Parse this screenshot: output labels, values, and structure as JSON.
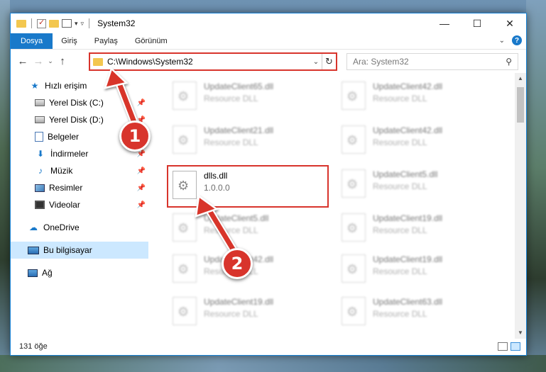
{
  "window": {
    "title": "System32"
  },
  "ribbon": {
    "tabs": [
      "Dosya",
      "Giriş",
      "Paylaş",
      "Görünüm"
    ]
  },
  "address": {
    "path": "C:\\Windows\\System32"
  },
  "search": {
    "placeholder": "Ara: System32"
  },
  "sidebar": {
    "items": [
      {
        "label": "Hızlı erişim",
        "icon": "star-icon"
      },
      {
        "label": "Yerel Disk (C:)",
        "icon": "drive-icon",
        "pinned": true
      },
      {
        "label": "Yerel Disk (D:)",
        "icon": "drive-icon",
        "pinned": true
      },
      {
        "label": "Belgeler",
        "icon": "document-icon",
        "pinned": true
      },
      {
        "label": "İndirmeler",
        "icon": "download-icon",
        "pinned": true
      },
      {
        "label": "Müzik",
        "icon": "music-icon",
        "pinned": true
      },
      {
        "label": "Resimler",
        "icon": "picture-icon",
        "pinned": true
      },
      {
        "label": "Videolar",
        "icon": "video-icon",
        "pinned": true
      },
      {
        "label": "OneDrive",
        "icon": "cloud-icon"
      },
      {
        "label": "Bu bilgisayar",
        "icon": "computer-icon",
        "selected": true
      },
      {
        "label": "Ağ",
        "icon": "network-icon"
      }
    ]
  },
  "files": [
    {
      "name": "UpdateClient65.dll",
      "desc": "Resource DLL"
    },
    {
      "name": "UpdateClient42.dll",
      "desc": "Resource DLL"
    },
    {
      "name": "UpdateClient21.dll",
      "desc": "Resource DLL"
    },
    {
      "name": "UpdateClient42.dll",
      "desc": "Resource DLL"
    },
    {
      "name": "dlls.dll",
      "desc": "1.0.0.0"
    },
    {
      "name": "UpdateClient5.dll",
      "desc": "Resource DLL"
    },
    {
      "name": "UpdateClient5.dll",
      "desc": "Resource DLL"
    },
    {
      "name": "UpdateClient19.dll",
      "desc": "Resource DLL"
    },
    {
      "name": "UpdateClient42.dll",
      "desc": "Resource DLL"
    },
    {
      "name": "UpdateClient19.dll",
      "desc": "Resource DLL"
    },
    {
      "name": "UpdateClient19.dll",
      "desc": "Resource DLL"
    },
    {
      "name": "UpdateClient63.dll",
      "desc": "Resource DLL"
    }
  ],
  "status": {
    "count": "131 öğe"
  },
  "annotations": {
    "step1": "1",
    "step2": "2",
    "color": "#d8342c"
  }
}
